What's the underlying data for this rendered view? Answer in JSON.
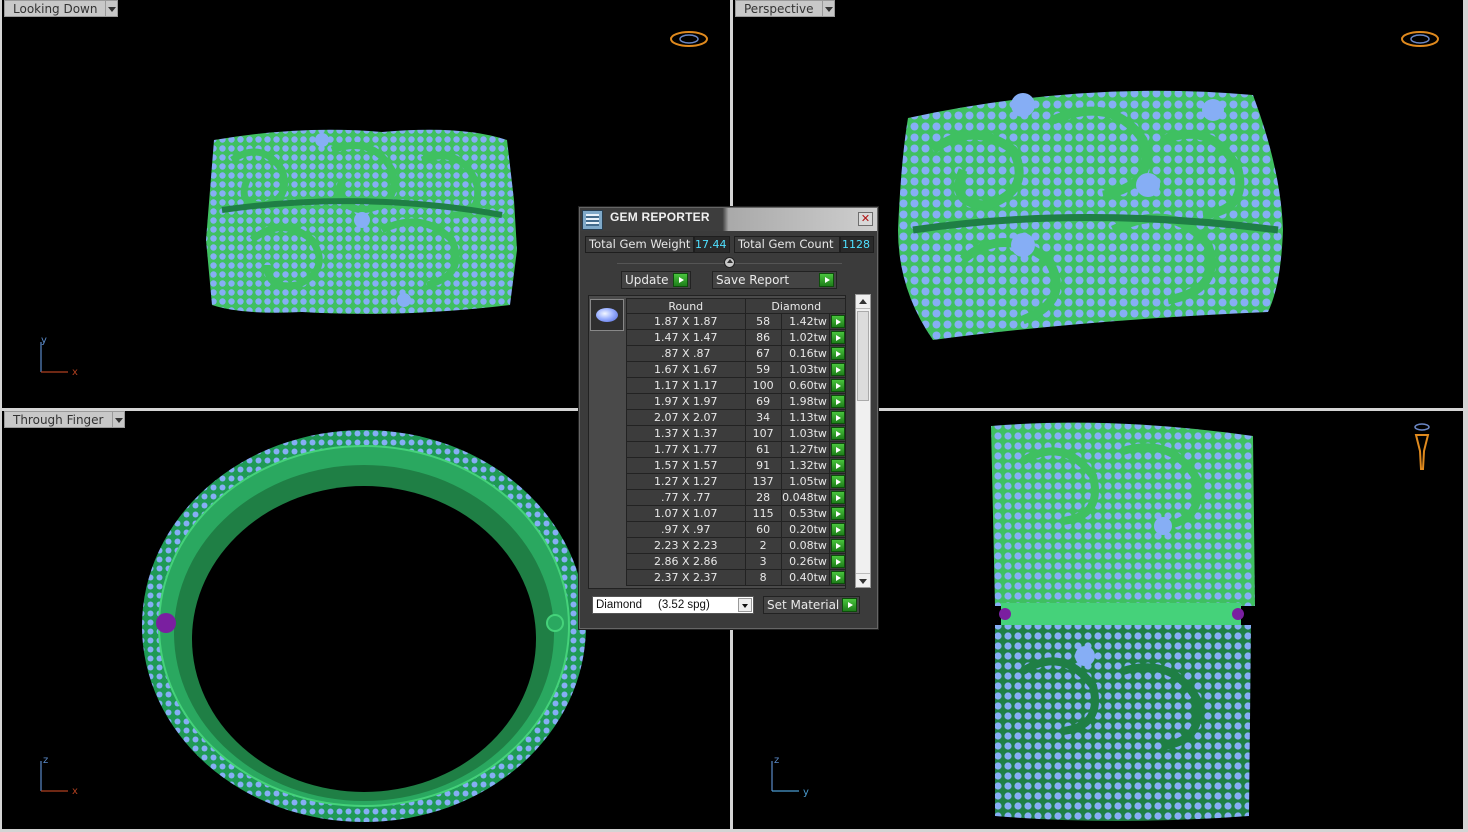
{
  "viewports": {
    "top": {
      "label": "Looking Down",
      "axis1": "x",
      "axis2": "y"
    },
    "perspective": {
      "label": "Perspective"
    },
    "front": {
      "label": "Through Finger",
      "axis1": "x",
      "axis2": "z"
    },
    "side": {
      "axis1": "y",
      "axis2": "z"
    }
  },
  "colors": {
    "metal": "#3fc061",
    "metal_dark": "#1f7f45",
    "gems": "#86aef5",
    "accent_gem": "#7a1fa0",
    "background": "#000000"
  },
  "gem_reporter": {
    "title": "GEM REPORTER",
    "close_icon": "close-icon",
    "total_weight_label": "Total Gem Weight",
    "total_weight_value": "17.44",
    "total_count_label": "Total Gem Count",
    "total_count_value": "1128",
    "update_label": "Update",
    "save_label": "Save Report",
    "columns": {
      "shape": "Round",
      "material": "Diamond"
    },
    "rows": [
      {
        "size": "1.87 X 1.87",
        "count": "58",
        "weight": "1.42tw"
      },
      {
        "size": "1.47 X 1.47",
        "count": "86",
        "weight": "1.02tw"
      },
      {
        "size": ".87 X .87",
        "count": "67",
        "weight": "0.16tw"
      },
      {
        "size": "1.67 X 1.67",
        "count": "59",
        "weight": "1.03tw"
      },
      {
        "size": "1.17 X 1.17",
        "count": "100",
        "weight": "0.60tw"
      },
      {
        "size": "1.97 X 1.97",
        "count": "69",
        "weight": "1.98tw"
      },
      {
        "size": "2.07 X 2.07",
        "count": "34",
        "weight": "1.13tw"
      },
      {
        "size": "1.37 X 1.37",
        "count": "107",
        "weight": "1.03tw"
      },
      {
        "size": "1.77 X 1.77",
        "count": "61",
        "weight": "1.27tw"
      },
      {
        "size": "1.57 X 1.57",
        "count": "91",
        "weight": "1.32tw"
      },
      {
        "size": "1.27 X 1.27",
        "count": "137",
        "weight": "1.05tw"
      },
      {
        "size": ".77 X .77",
        "count": "28",
        "weight": "0.048tw"
      },
      {
        "size": "1.07 X 1.07",
        "count": "115",
        "weight": "0.53tw"
      },
      {
        "size": ".97 X .97",
        "count": "60",
        "weight": "0.20tw"
      },
      {
        "size": "2.23 X 2.23",
        "count": "2",
        "weight": "0.08tw"
      },
      {
        "size": "2.86 X 2.86",
        "count": "3",
        "weight": "0.26tw"
      },
      {
        "size": "2.37 X 2.37",
        "count": "8",
        "weight": "0.40tw"
      }
    ],
    "material_select": "Diamond     (3.52 spg)",
    "set_material_label": "Set Material"
  }
}
